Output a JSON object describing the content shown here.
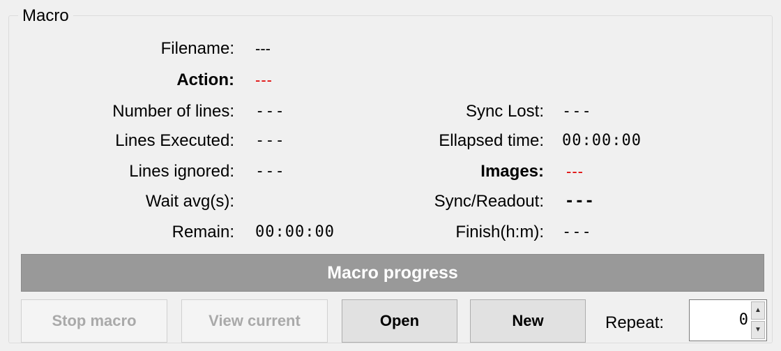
{
  "group": {
    "title": "Macro"
  },
  "fields": {
    "filename": {
      "label": "Filename:",
      "value": "---"
    },
    "action": {
      "label": "Action:",
      "value": "---"
    },
    "number_of_lines": {
      "label": "Number of lines:",
      "value": "---"
    },
    "lines_executed": {
      "label": "Lines Executed:",
      "value": "---"
    },
    "lines_ignored": {
      "label": "Lines ignored:",
      "value": "---"
    },
    "wait_avg": {
      "label": "Wait avg(s):",
      "value": ""
    },
    "remain": {
      "label": "Remain:",
      "value": "00:00:00"
    },
    "sync_lost": {
      "label": "Sync Lost:",
      "value": "---"
    },
    "ellapsed_time": {
      "label": "Ellapsed time:",
      "value": "00:00:00"
    },
    "images": {
      "label": "Images:",
      "value": "---"
    },
    "sync_readout": {
      "label": "Sync/Readout:",
      "value": "---"
    },
    "finish": {
      "label": "Finish(h:m):",
      "value": "---"
    }
  },
  "progress": {
    "label": "Macro progress",
    "percent": 0
  },
  "buttons": {
    "stop_macro": "Stop macro",
    "view_current": "View current",
    "open": "Open",
    "new": "New"
  },
  "repeat": {
    "label": "Repeat:",
    "value": "0"
  },
  "colors": {
    "red_value": "#e00000",
    "progress_bg": "#999999"
  }
}
